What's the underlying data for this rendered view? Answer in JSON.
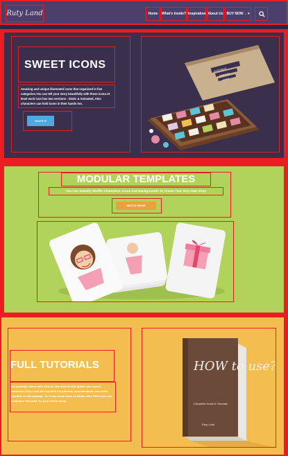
{
  "nav": {
    "logo": "Ruty Land",
    "menu": [
      {
        "label": "Home"
      },
      {
        "label": "What's Inside? ▾"
      },
      {
        "label": "Inspiration"
      },
      {
        "label": "About Us"
      },
      {
        "label": "BUY NOW→ ▾"
      }
    ]
  },
  "sweet_icons": {
    "title": "SWEET ICONS",
    "description": "Amazing and unique illustrated icons that organized in five categories.You can tell your story beautifully with these icons.At least each icon has two versions : Static & Animated, Also characters can hold icons in their hands too.",
    "button_label": "TASTE IT",
    "box_labels": [
      "CUSTOMIZE",
      "ANIMATED",
      "STATIC"
    ]
  },
  "modular": {
    "title": "MODULAR TEMPLATES",
    "subtitle": "You Can Sweetly Shuffle Characters, Icons And Backgrounds To Create Your Very Own Story",
    "button_label": "WATCH MORE"
  },
  "tutorials": {
    "title": "FULL TUTORIALS",
    "description": "the package comes with step by step tutorial that guides you how to customize Ruty Land.We included full tutorials, documentation and video tutorials for the package. So if you know basic of Adobe After Effect you can customize this pack for your needs easily.",
    "book_title": "HOW to use?",
    "book_subtitle": "Complete Guide & Tutorials",
    "book_author": "Ruty Land"
  },
  "colors": {
    "nav_bg": "#4c3f6b",
    "section1_bg": "#3a304e",
    "section2_bg": "#b1d35c",
    "section3_bg": "#f3bd50",
    "accent_blue": "#4da9e2",
    "accent_orange": "#e8a33d",
    "outline": "#ec1c24"
  }
}
